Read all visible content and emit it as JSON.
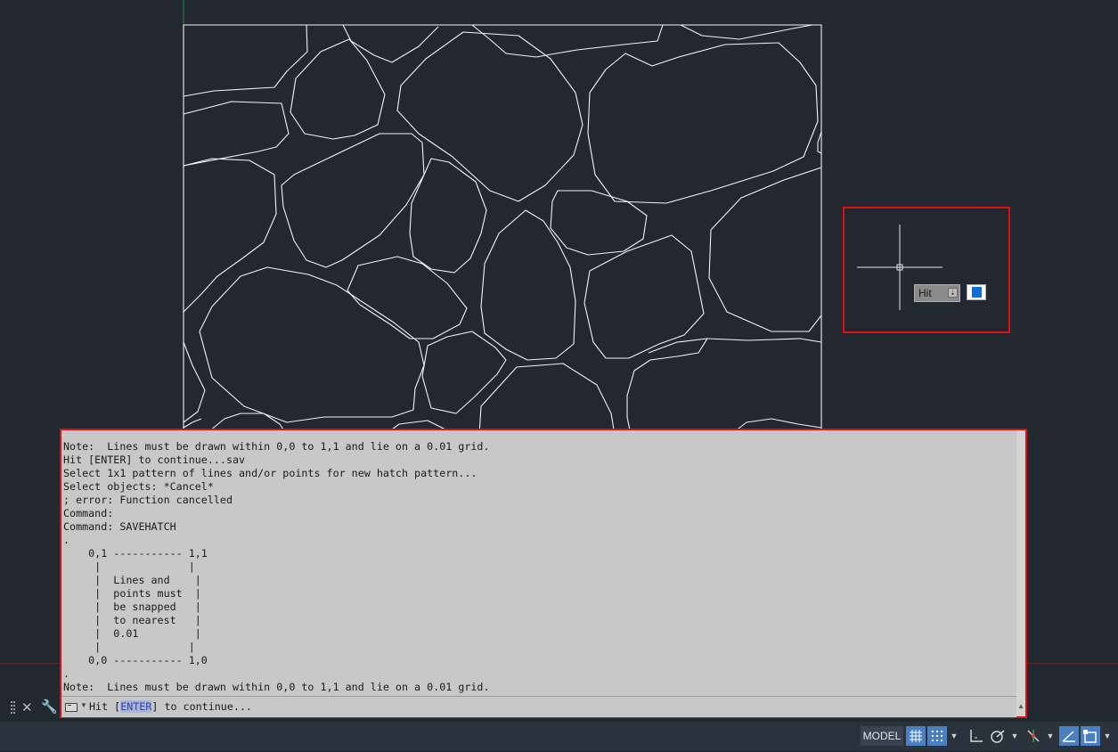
{
  "command_line": {
    "history": [
      "Note:  Lines must be drawn within 0,0 to 1,1 and lie on a 0.01 grid.",
      "Hit [ENTER] to continue...sav",
      "Select 1x1 pattern of lines and/or points for new hatch pattern...",
      "Select objects: *Cancel*",
      "; error: Function cancelled",
      "Command:",
      "Command: SAVEHATCH",
      ".",
      "    0,1 ----------- 1,1",
      "     |              |",
      "     |  Lines and    |",
      "     |  points must  |",
      "     |  be snapped   |",
      "     |  to nearest   |",
      "     |  0.01         |",
      "     |              |",
      "    0,0 ----------- 1,0",
      ".",
      "Note:  Lines must be drawn within 0,0 to 1,1 and lie on a 0.01 grid."
    ],
    "prompt_before": "Hit [",
    "prompt_option": "ENTER",
    "prompt_after": "] to continue..."
  },
  "cursor_tooltip": {
    "input_value": "Hit",
    "swatch_color": "#0a6ed8"
  },
  "status_bar": {
    "model_label": "MODEL",
    "buttons": [
      "grid-icon",
      "snap-icon",
      "ortho-icon",
      "polar-icon",
      "osnap-icon",
      "lineweight-icon",
      "select-icon"
    ]
  },
  "colors": {
    "canvas_bg": "#212830",
    "linework": "#f2f2f2",
    "highlight_border": "#e01010",
    "command_bg": "#c8c8c8",
    "active_toggle": "#4a7fc1"
  }
}
